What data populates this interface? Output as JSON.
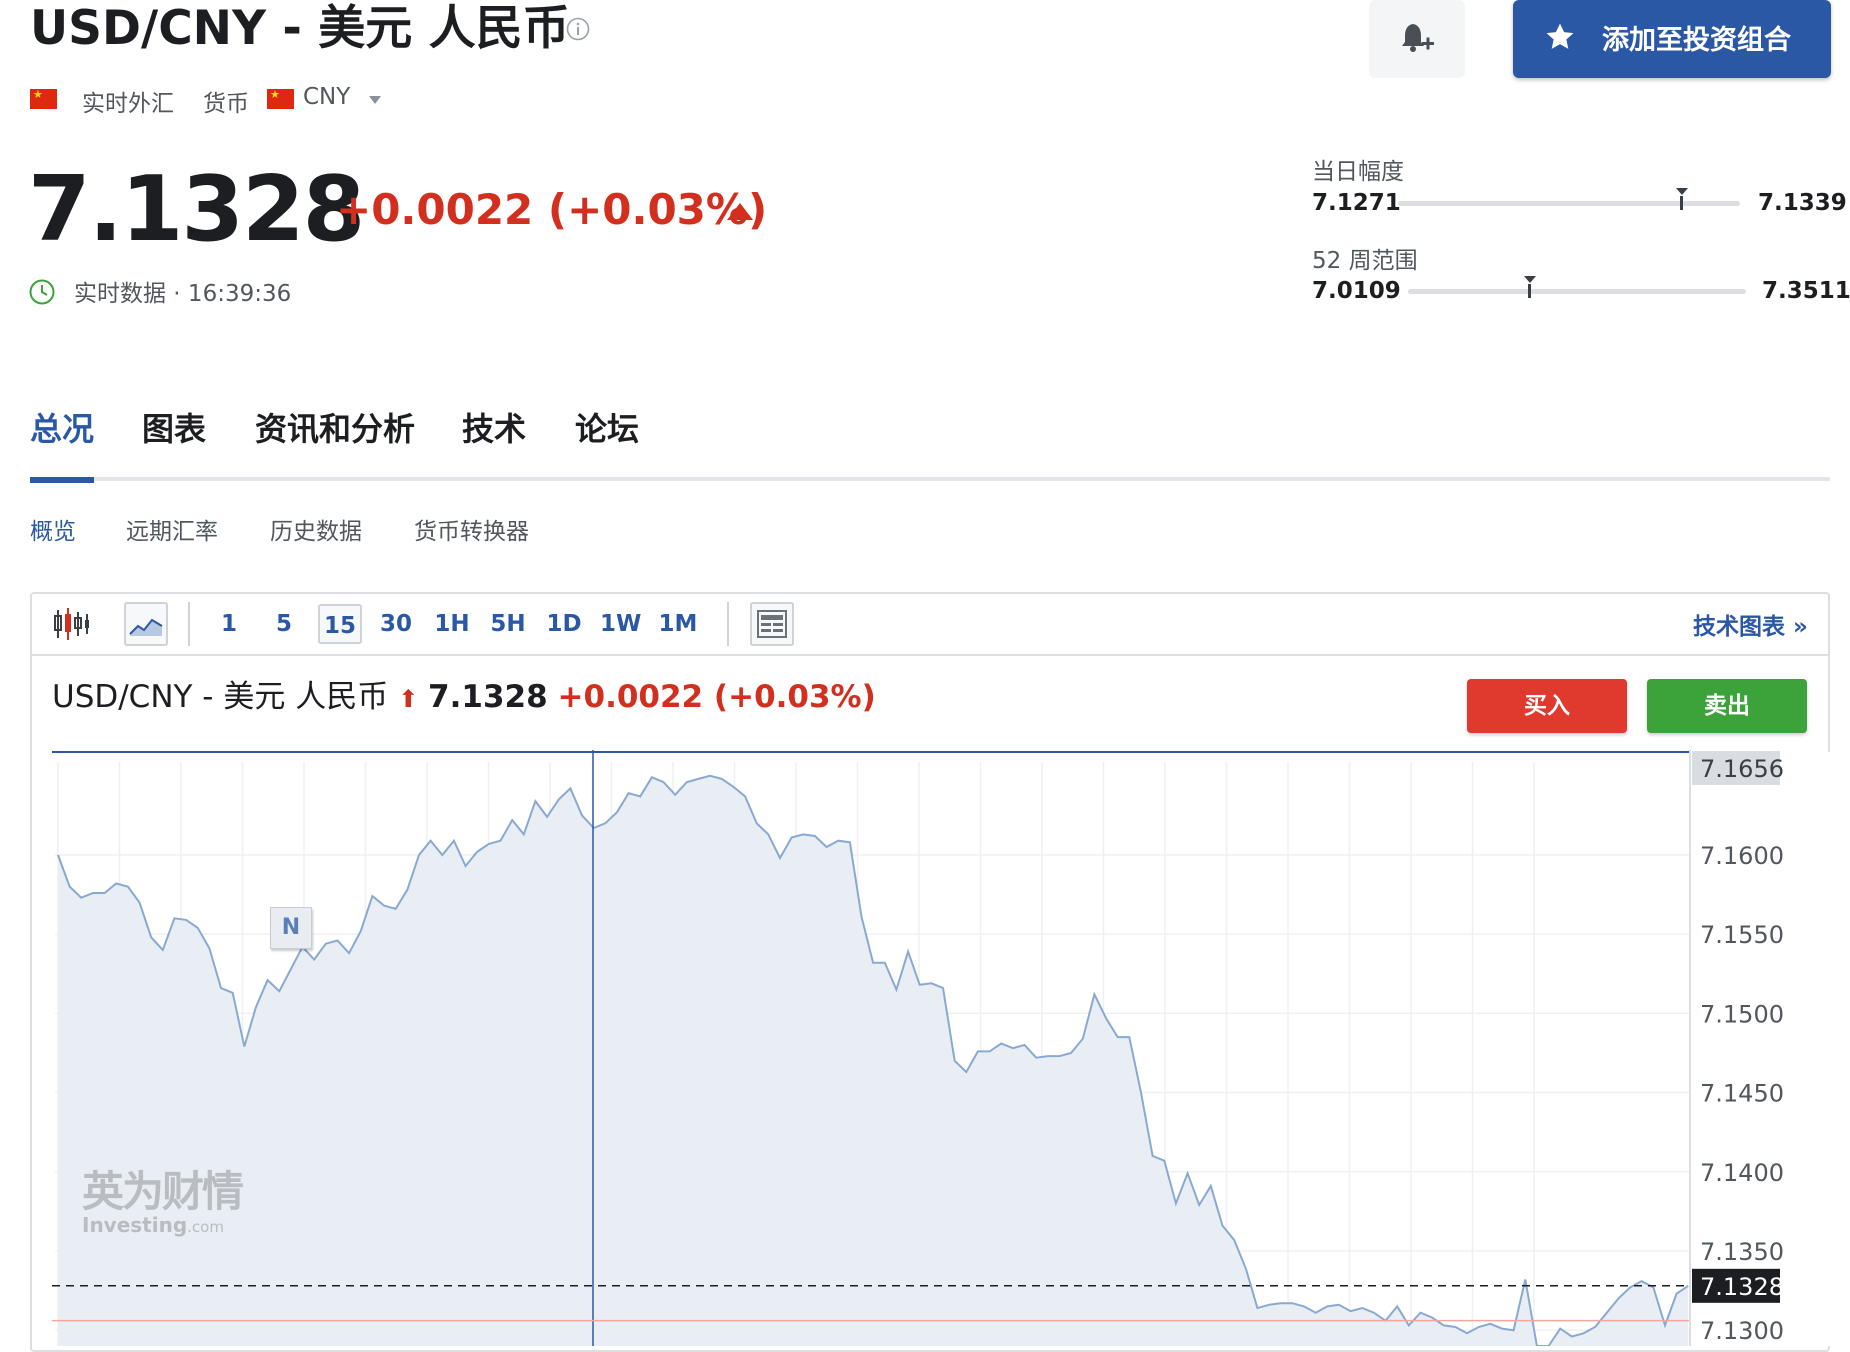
{
  "header": {
    "title": "USD/CNY - 美元 人民币",
    "portfolio_label": "添加至投资组合",
    "meta": {
      "market": "实时外汇",
      "type": "货币",
      "currency": "CNY"
    }
  },
  "quote": {
    "price": "7.1328",
    "change": "+0.0022 (+0.03%)",
    "realtime_label": "实时数据 · 16:39:36"
  },
  "ranges": {
    "day": {
      "label": "当日幅度",
      "low": "7.1271",
      "high": "7.1339",
      "position": 0.83
    },
    "week52": {
      "label": "52 周范围",
      "low": "7.0109",
      "high": "7.3511",
      "position": 0.36
    }
  },
  "tabs": [
    "总况",
    "图表",
    "资讯和分析",
    "技术",
    "论坛"
  ],
  "subtabs": [
    "概览",
    "远期汇率",
    "历史数据",
    "货币转换器"
  ],
  "chart_toolbar": {
    "intervals": [
      "1",
      "5",
      "15",
      "30",
      "1H",
      "5H",
      "1D",
      "1W",
      "1M"
    ],
    "active_interval": "15",
    "tech_chart_label": "技术图表 »"
  },
  "chart_header": {
    "symbol": "USD/CNY - 美元 人民币",
    "arrow": "⬆",
    "price": "7.1328",
    "change": "+0.0022 (+0.03%)",
    "buy": "买入",
    "sell": "卖出"
  },
  "watermark": {
    "cn": "英为财情",
    "en": "Investing",
    "en_suffix": ".com"
  },
  "colors": {
    "accent": "#2b58a5",
    "up": "#d22f1f",
    "buy": "#e03a2f",
    "sell": "#3ca23a",
    "line": "#8aa9d0"
  },
  "chart_data": {
    "type": "area",
    "ylim": [
      7.129,
      7.1665
    ],
    "y_ticks": [
      7.16,
      7.155,
      7.15,
      7.145,
      7.14,
      7.135,
      7.13
    ],
    "top_price_label": "7.1656",
    "current_price_label": "7.1328",
    "current_value": 7.1328,
    "reference_value": 7.1306,
    "x_index_max": 138,
    "values": [
      7.16,
      7.158,
      7.1573,
      7.1576,
      7.1576,
      7.1582,
      7.158,
      7.157,
      7.1548,
      7.154,
      7.156,
      7.1559,
      7.1554,
      7.1541,
      7.1516,
      7.1513,
      7.1479,
      7.1504,
      7.1521,
      7.1514,
      7.1528,
      7.1542,
      7.1534,
      7.1544,
      7.1546,
      7.1538,
      7.1552,
      7.1574,
      7.1568,
      7.1566,
      7.1578,
      7.16,
      7.1609,
      7.16,
      7.1609,
      7.1593,
      7.1602,
      7.1607,
      7.1609,
      7.1622,
      7.1613,
      7.1634,
      7.1624,
      7.1635,
      7.1642,
      7.1625,
      7.1617,
      7.162,
      7.1627,
      7.1639,
      7.1637,
      7.1649,
      7.1646,
      7.1638,
      7.1646,
      7.1648,
      7.165,
      7.1648,
      7.1643,
      7.1637,
      7.162,
      7.1613,
      7.1598,
      7.1611,
      7.1613,
      7.1612,
      7.1605,
      7.1609,
      7.1608,
      7.1561,
      7.1532,
      7.1532,
      7.1515,
      7.1539,
      7.1518,
      7.1519,
      7.1516,
      7.147,
      7.1463,
      7.1476,
      7.1476,
      7.1481,
      7.1478,
      7.148,
      7.1472,
      7.1473,
      7.1473,
      7.1475,
      7.1484,
      7.1512,
      7.1497,
      7.1485,
      7.1485,
      7.145,
      7.141,
      7.1407,
      7.138,
      7.1399,
      7.1379,
      7.1391,
      7.1366,
      7.1357,
      7.1339,
      7.1314,
      7.1316,
      7.1317,
      7.1317,
      7.1315,
      7.1311,
      7.1315,
      7.1316,
      7.1312,
      7.1314,
      7.1311,
      7.1306,
      7.1315,
      7.1303,
      7.1311,
      7.1308,
      7.1303,
      7.1302,
      7.1298,
      7.1302,
      7.1304,
      7.1301,
      7.13,
      7.1332,
      7.129,
      7.129,
      7.1301,
      7.1296,
      7.1298,
      7.1302,
      7.1311,
      7.132,
      7.1327,
      7.1331,
      7.1327,
      7.1303,
      7.1323,
      7.1328
    ]
  }
}
